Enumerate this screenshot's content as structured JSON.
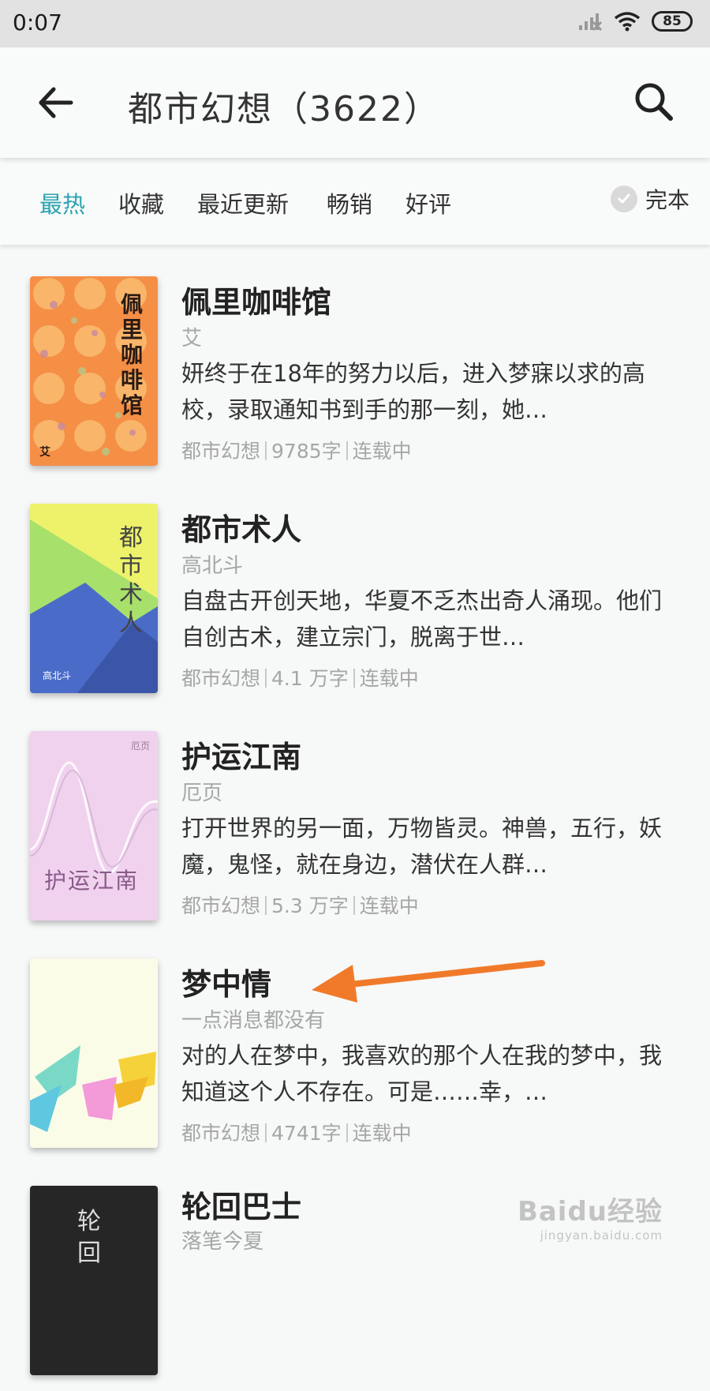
{
  "status_bar": {
    "time": "0:07",
    "battery": "85"
  },
  "app_bar": {
    "title": "都市幻想（3622）"
  },
  "filters": {
    "tabs": [
      {
        "label": "最热",
        "active": true
      },
      {
        "label": "收藏",
        "active": false
      },
      {
        "label": "最近更新",
        "active": false
      },
      {
        "label": "畅销",
        "active": false
      },
      {
        "label": "好评",
        "active": false
      }
    ],
    "complete_label": "完本"
  },
  "books": [
    {
      "title": "佩里咖啡馆",
      "author": "艾",
      "desc": "妍终于在18年的努力以后，进入梦寐以求的高校，录取通知书到手的那一刻，她…",
      "genre": "都市幻想",
      "words": "9785字",
      "status": "连载中",
      "cover_title": "佩里咖啡馆",
      "cover_author": "艾"
    },
    {
      "title": "都市术人",
      "author": "高北斗",
      "desc": "自盘古开创天地，华夏不乏杰出奇人涌现。他们自创古术，建立宗门，脱离于世…",
      "genre": "都市幻想",
      "words": "4.1 万字",
      "status": "连载中",
      "cover_title": "都市术人",
      "cover_author": "高北斗"
    },
    {
      "title": "护运江南",
      "author": "厄页",
      "desc": "打开世界的另一面，万物皆灵。神兽，五行，妖魔，鬼怪，就在身边，潜伏在人群…",
      "genre": "都市幻想",
      "words": "5.3 万字",
      "status": "连载中",
      "cover_title": "护运江南",
      "cover_author": "厄页"
    },
    {
      "title": "梦中情",
      "author": "一点消息都没有",
      "desc": "对的人在梦中，我喜欢的那个人在我的梦中，我知道这个人不存在。可是……幸，…",
      "genre": "都市幻想",
      "words": "4741字",
      "status": "连载中"
    },
    {
      "title": "轮回巴士",
      "author": "落笔今夏",
      "cover_title": "轮回"
    }
  ],
  "watermark": {
    "brand": "Baidu经验",
    "url": "jingyan.baidu.com"
  },
  "colors": {
    "accent": "#2aa3b0",
    "arrow": "#f07a2a"
  }
}
